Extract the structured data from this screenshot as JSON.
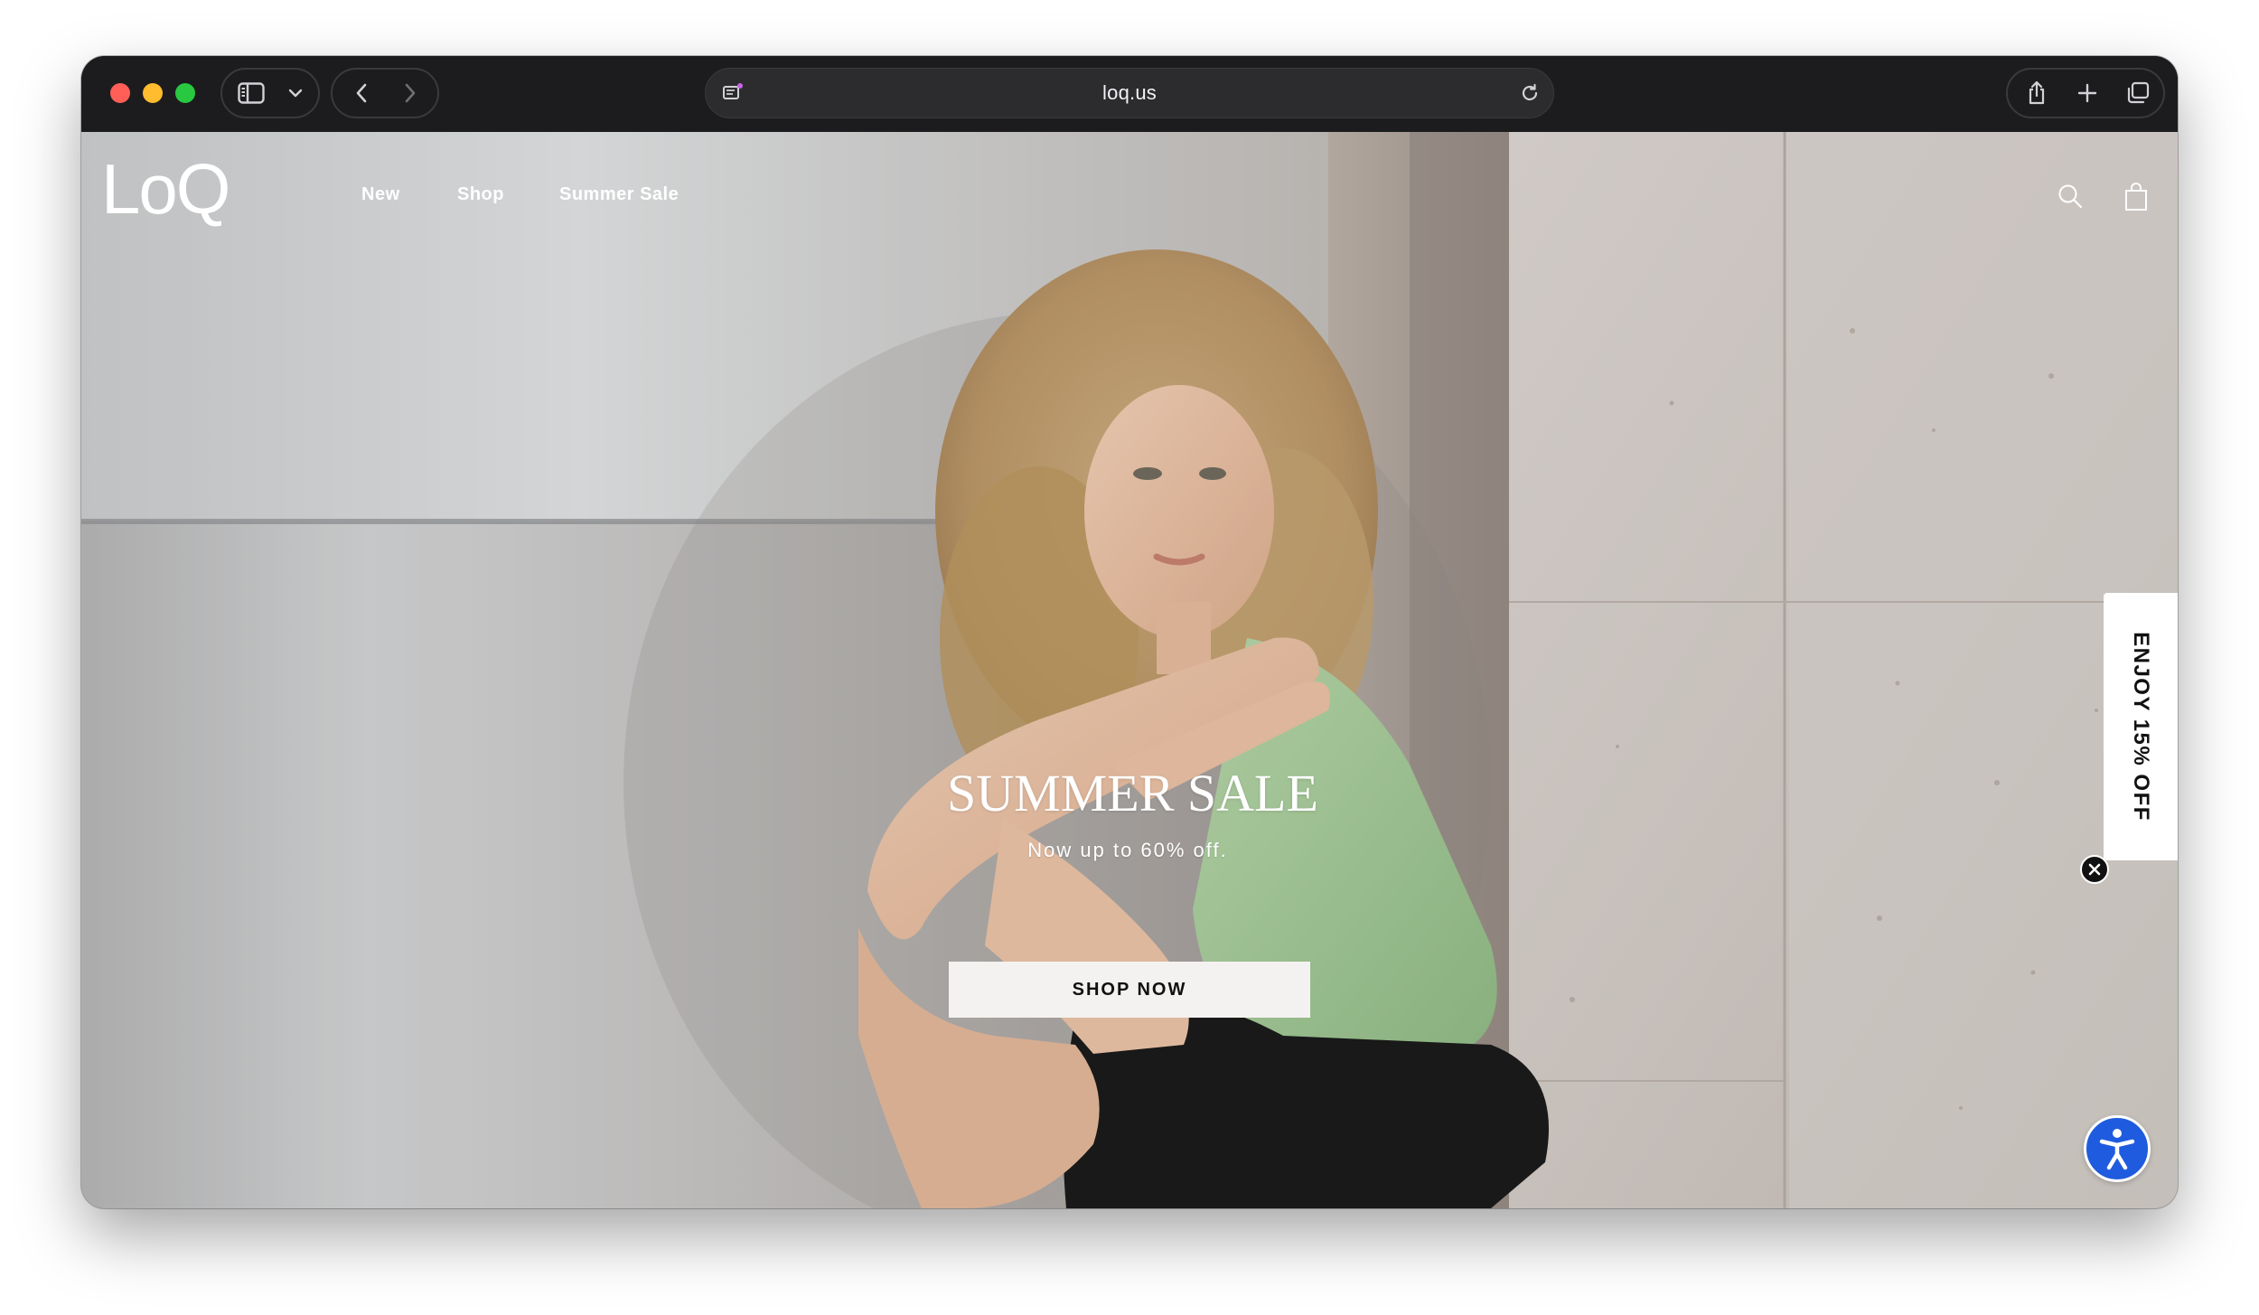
{
  "browser": {
    "url": "loq.us",
    "icons": {
      "sidebar": "sidebar-icon",
      "dropdown": "chevron-down-icon",
      "back": "chevron-left-icon",
      "forward": "chevron-right-icon",
      "site_info": "page-info-icon",
      "reload": "reload-icon",
      "share": "share-icon",
      "new_tab": "plus-icon",
      "tabs": "tab-overview-icon"
    }
  },
  "site": {
    "logo": "LoQ",
    "nav": [
      {
        "label": "New"
      },
      {
        "label": "Shop"
      },
      {
        "label": "Summer Sale"
      }
    ],
    "header_icons": {
      "search": "search-icon",
      "cart": "shopping-bag-icon"
    },
    "hero": {
      "title": "SUMMER SALE",
      "subtitle": "Now up to 60% off.",
      "cta": "SHOP NOW"
    },
    "promo_tab": {
      "label": "ENJOY 15% OFF",
      "close_icon": "close-icon"
    },
    "accessibility": {
      "icon": "accessibility-icon",
      "color": "#1f5bde"
    }
  }
}
